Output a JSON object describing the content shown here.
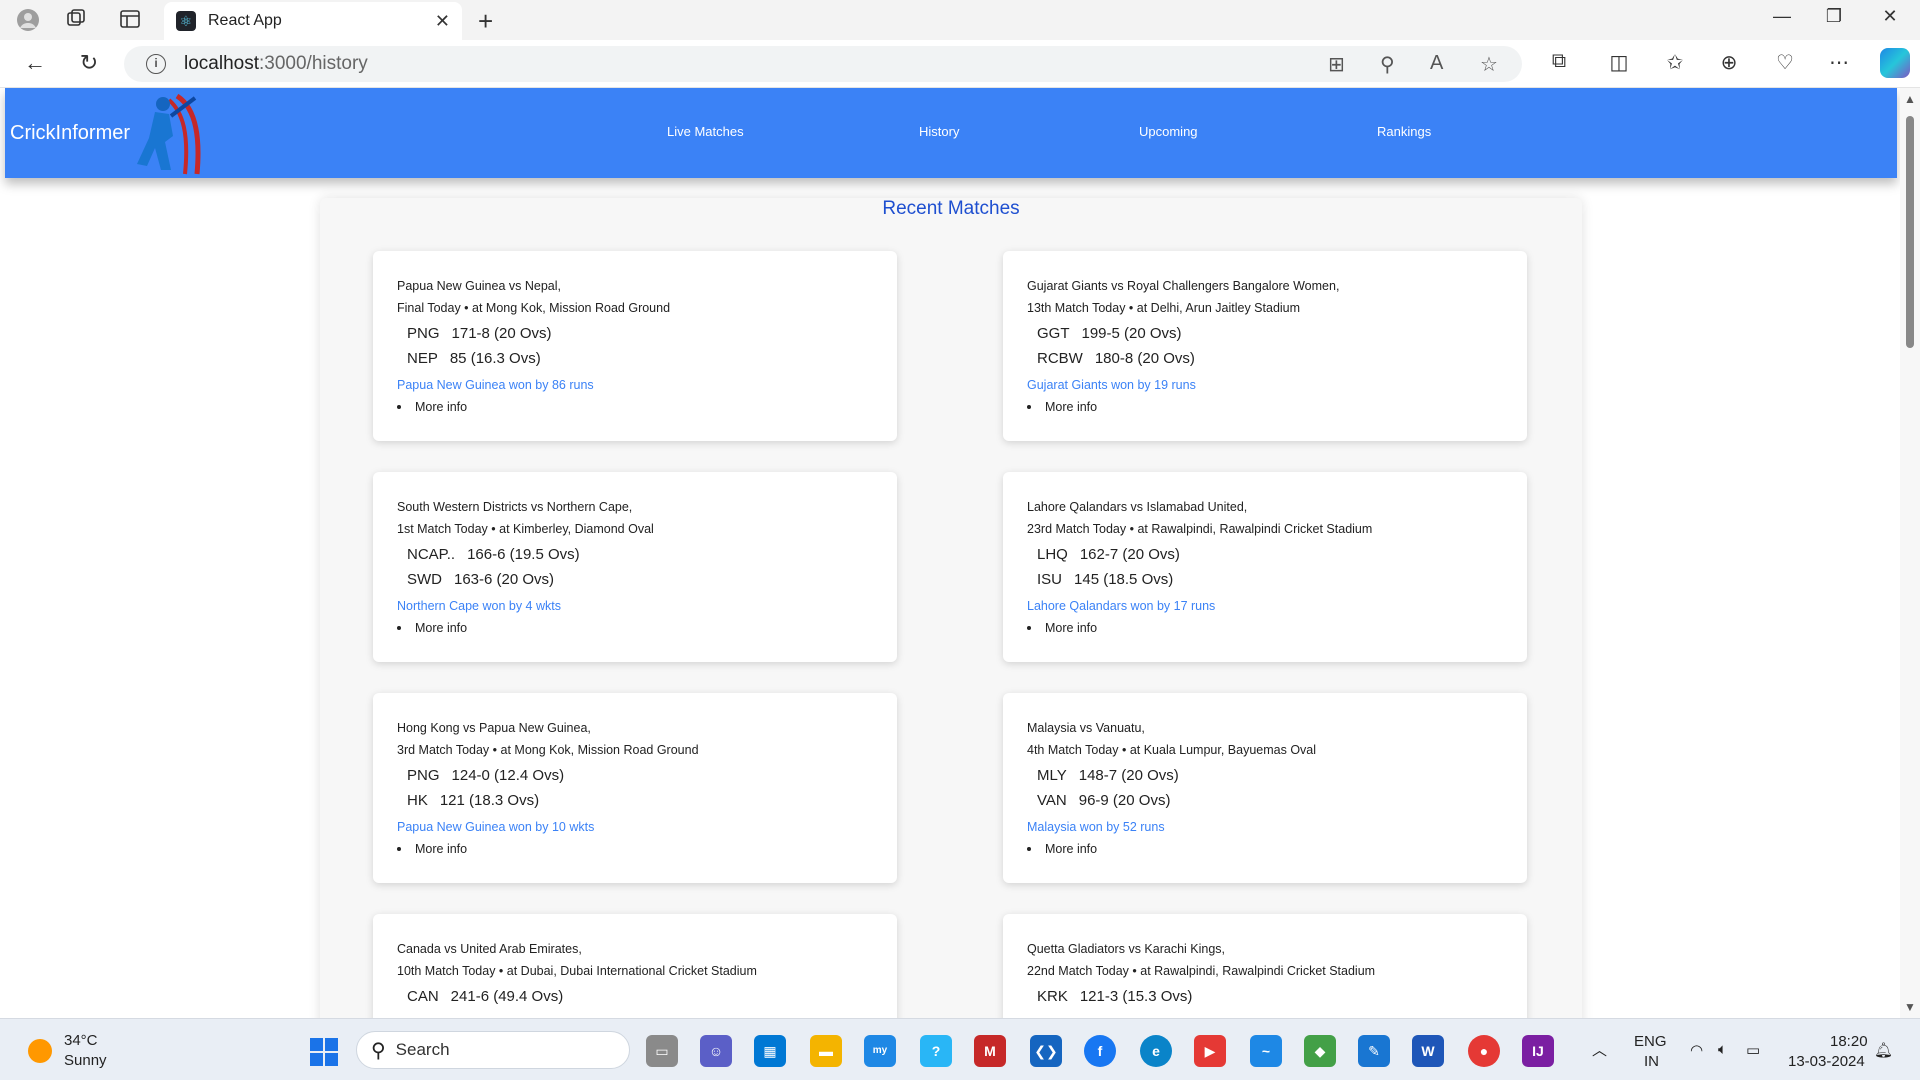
{
  "browser": {
    "tab_title": "React App",
    "url_host": "localhost",
    "url_rest": ":3000/history"
  },
  "page": {
    "brand": "CrickInformer",
    "nav": [
      "Live Matches",
      "History",
      "Upcoming",
      "Rankings"
    ],
    "heading": "Recent Matches",
    "matches": [
      {
        "teams": "Papua New Guinea vs Nepal,",
        "desc": "Final Today • at Mong Kok, Mission Road Ground",
        "t1": "PNG",
        "s1": "171-8 (20 Ovs)",
        "t2": "NEP",
        "s2": "85 (16.3 Ovs)",
        "result": "Papua New Guinea won by 86 runs",
        "more": "More info"
      },
      {
        "teams": "Gujarat Giants vs Royal Challengers Bangalore Women,",
        "desc": "13th Match Today • at Delhi, Arun Jaitley Stadium",
        "t1": "GGT",
        "s1": "199-5 (20 Ovs)",
        "t2": "RCBW",
        "s2": "180-8 (20 Ovs)",
        "result": "Gujarat Giants won by 19 runs",
        "more": "More info"
      },
      {
        "teams": "South Western Districts vs Northern Cape,",
        "desc": "1st Match Today • at Kimberley, Diamond Oval",
        "t1": "NCAP..",
        "s1": "166-6 (19.5 Ovs)",
        "t2": "SWD",
        "s2": "163-6 (20 Ovs)",
        "result": "Northern Cape won by 4 wkts",
        "more": "More info"
      },
      {
        "teams": "Lahore Qalandars vs Islamabad United,",
        "desc": "23rd Match Today • at Rawalpindi, Rawalpindi Cricket Stadium",
        "t1": "LHQ",
        "s1": "162-7 (20 Ovs)",
        "t2": "ISU",
        "s2": "145 (18.5 Ovs)",
        "result": "Lahore Qalandars won by 17 runs",
        "more": "More info"
      },
      {
        "teams": "Hong Kong vs Papua New Guinea,",
        "desc": "3rd Match Today • at Mong Kok, Mission Road Ground",
        "t1": "PNG",
        "s1": "124-0 (12.4 Ovs)",
        "t2": "HK",
        "s2": "121 (18.3 Ovs)",
        "result": "Papua New Guinea won by 10 wkts",
        "more": "More info"
      },
      {
        "teams": "Malaysia vs Vanuatu,",
        "desc": "4th Match Today • at Kuala Lumpur, Bayuemas Oval",
        "t1": "MLY",
        "s1": "148-7 (20 Ovs)",
        "t2": "VAN",
        "s2": "96-9 (20 Ovs)",
        "result": "Malaysia won by 52 runs",
        "more": "More info"
      },
      {
        "teams": "Canada vs United Arab Emirates,",
        "desc": "10th Match Today • at Dubai, Dubai International Cricket Stadium",
        "t1": "CAN",
        "s1": "241-6 (49.4 Ovs)",
        "t2": "",
        "s2": "",
        "result": "",
        "more": ""
      },
      {
        "teams": "Quetta Gladiators vs Karachi Kings,",
        "desc": "22nd Match Today • at Rawalpindi, Rawalpindi Cricket Stadium",
        "t1": "KRK",
        "s1": "121-3 (15.3 Ovs)",
        "t2": "",
        "s2": "",
        "result": "",
        "more": ""
      }
    ]
  },
  "taskbar": {
    "temp": "34°C",
    "condition": "Sunny",
    "search": "Search",
    "lang1": "ENG",
    "lang2": "IN",
    "time": "18:20",
    "date": "13-03-2024"
  },
  "colors": {
    "navbar": "#3b82f6",
    "heading": "#1e4fd0",
    "result": "#3b82f6"
  }
}
